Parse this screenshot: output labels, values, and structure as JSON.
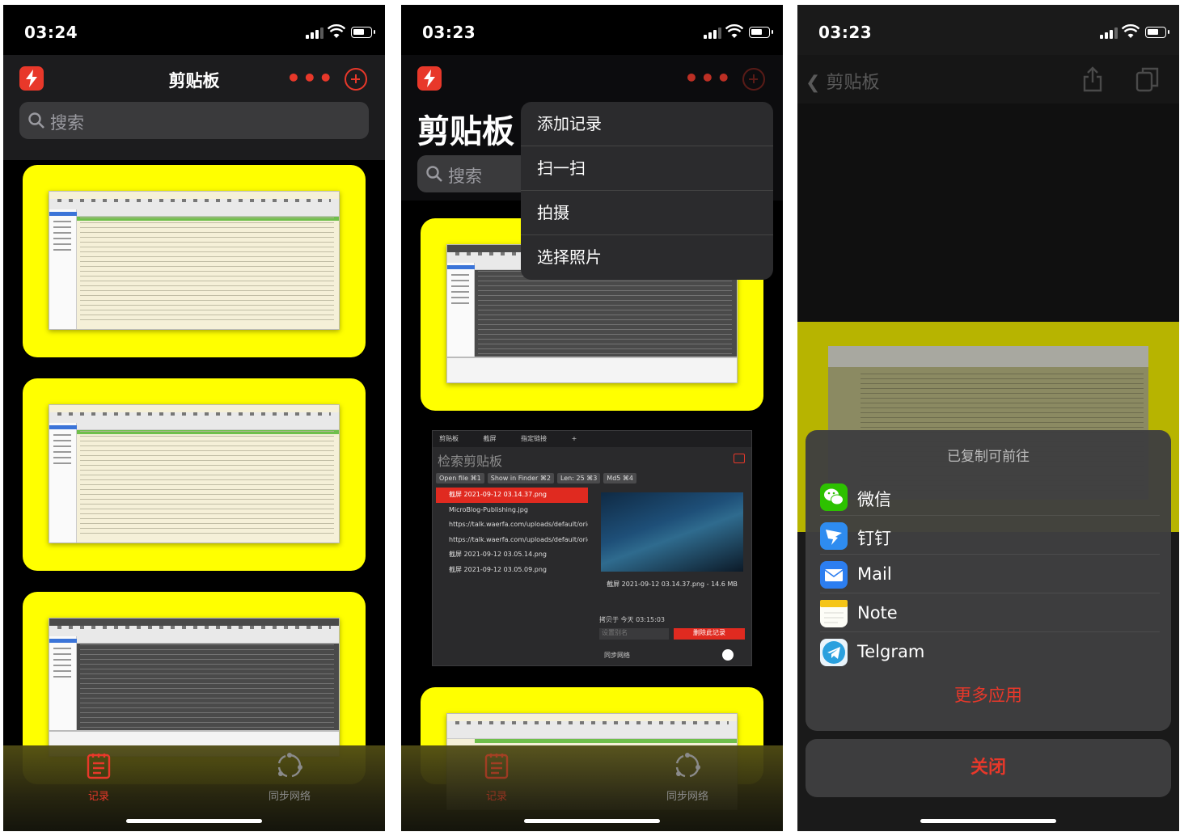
{
  "status": {
    "screen1_time": "03:24",
    "screen2_time": "03:23",
    "screen3_time": "03:23"
  },
  "screen1": {
    "title": "剪贴板",
    "search_placeholder": "搜索",
    "tabs": [
      {
        "label": "记录"
      },
      {
        "label": "同步网络"
      }
    ]
  },
  "screen2": {
    "title": "剪贴板",
    "search_placeholder": "搜索",
    "menu": [
      "添加记录",
      "扫一扫",
      "拍摄",
      "选择照片"
    ],
    "clip_window": {
      "tabs": [
        "剪贴板",
        "截屏",
        "指定链接",
        "+"
      ],
      "search_placeholder": "检索剪贴板",
      "chips": [
        "Open file ⌘1",
        "Show in Finder ⌘2",
        "Len: 25 ⌘3",
        "Md5 ⌘4"
      ],
      "rows": [
        "截屏 2021-09-12 03.14.37.png",
        "MicroBlog-Publishing.jpg",
        "https://talk.waerfa.com/uploads/default/orig",
        "https://talk.waerfa.com/uploads/default/orig",
        "截屏 2021-09-12 03.05.14.png",
        "截屏 2021-09-12 03.05.09.png"
      ],
      "preview_caption": "截屏 2021-09-12 03.14.37.png - 14.6 MB",
      "copied_meta": "拷贝于 今天 03:15:03",
      "field_placeholder": "设置别名",
      "delete_label": "删除此记录",
      "sync_label": "同步网络"
    },
    "tabs": [
      {
        "label": "记录"
      },
      {
        "label": "同步网络"
      }
    ]
  },
  "screen3": {
    "back_label": "剪贴板",
    "sheet_title": "已复制可前往",
    "apps": [
      {
        "name": "微信",
        "icon": "wechat-icon",
        "color": "#2dc100"
      },
      {
        "name": "钉钉",
        "icon": "dingtalk-icon",
        "color": "#2e8cf0"
      },
      {
        "name": "Mail",
        "icon": "mail-icon",
        "color": "#2c7ef0"
      },
      {
        "name": "Note",
        "icon": "note-icon",
        "color": "#f5c518"
      },
      {
        "name": "Telgram",
        "icon": "telegram-icon",
        "color": "#2aa0de"
      }
    ],
    "more_label": "更多应用",
    "close_label": "关闭"
  },
  "colors": {
    "accent": "#e8382a",
    "card": "#ffff00"
  }
}
